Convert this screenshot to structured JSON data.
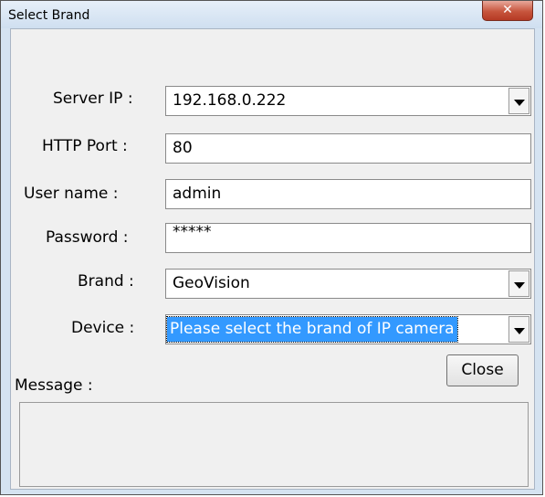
{
  "window": {
    "title": "Select Brand",
    "close_glyph": "✕",
    "close_icon": "close-icon"
  },
  "form": {
    "server_ip": {
      "label": "Server IP :",
      "value": "192.168.0.222"
    },
    "http_port": {
      "label": "HTTP Port :",
      "value": "80"
    },
    "user_name": {
      "label": "User name :",
      "value": "admin"
    },
    "password": {
      "label": "Password :",
      "value": "*****"
    },
    "brand": {
      "label": "Brand :",
      "value": "GeoVision"
    },
    "device": {
      "label": "Device :",
      "value": "Please select the brand of IP camera"
    }
  },
  "buttons": {
    "close_label": "Close"
  },
  "message": {
    "label": "Message :",
    "text": ""
  },
  "colors": {
    "selection": "#3399ff",
    "close_button": "#c7553d"
  }
}
